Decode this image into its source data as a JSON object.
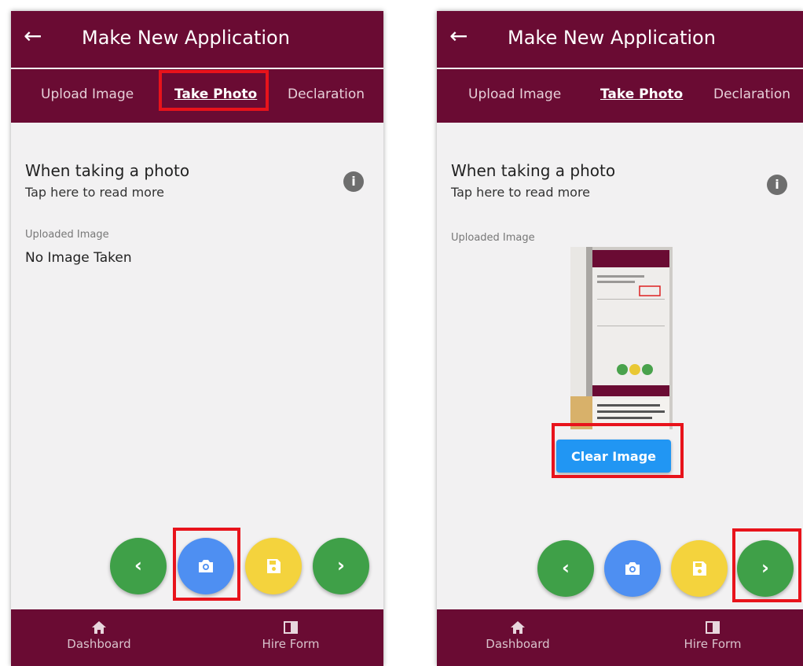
{
  "screens": [
    {
      "appbar": {
        "back_icon": "arrow-left-icon",
        "title": "Make New Application"
      },
      "tabs": [
        {
          "label": "Upload Image",
          "active": false
        },
        {
          "label": "Take Photo",
          "active": true
        },
        {
          "label": "Declaration",
          "active": false
        }
      ],
      "intro": {
        "title": "When taking a photo",
        "subtitle": "Tap here to read more",
        "icon": "info-icon"
      },
      "uploaded": {
        "label": "Uploaded Image",
        "value": "No Image Taken"
      },
      "fabs": [
        {
          "name": "previous",
          "icon": "chevron-left-icon",
          "color": "#3fa048"
        },
        {
          "name": "take-photo",
          "icon": "camera-icon",
          "color": "#4e8ff2"
        },
        {
          "name": "save",
          "icon": "save-icon",
          "color": "#f4d33d"
        },
        {
          "name": "next",
          "icon": "chevron-right-icon",
          "color": "#3fa048"
        }
      ],
      "bottom_nav": [
        {
          "label": "Dashboard",
          "icon": "home-icon"
        },
        {
          "label": "Hire Form",
          "icon": "form-icon"
        }
      ],
      "highlights": [
        "Take Photo tab",
        "camera button"
      ]
    },
    {
      "appbar": {
        "back_icon": "arrow-left-icon",
        "title": "Make New Application"
      },
      "tabs": [
        {
          "label": "Upload Image",
          "active": false
        },
        {
          "label": "Take Photo",
          "active": true
        },
        {
          "label": "Declaration",
          "active": false
        }
      ],
      "intro": {
        "title": "When taking a photo",
        "subtitle": "Tap here to read more",
        "icon": "info-icon"
      },
      "uploaded": {
        "label": "Uploaded Image",
        "clear_button": "Clear Image"
      },
      "fabs": [
        {
          "name": "previous",
          "icon": "chevron-left-icon",
          "color": "#3fa048"
        },
        {
          "name": "take-photo",
          "icon": "camera-icon",
          "color": "#4e8ff2"
        },
        {
          "name": "save",
          "icon": "save-icon",
          "color": "#f4d33d"
        },
        {
          "name": "next",
          "icon": "chevron-right-icon",
          "color": "#3fa048"
        }
      ],
      "bottom_nav": [
        {
          "label": "Dashboard",
          "icon": "home-icon"
        },
        {
          "label": "Hire Form",
          "icon": "form-icon"
        }
      ],
      "highlights": [
        "Clear Image button",
        "next button"
      ]
    }
  ],
  "colors": {
    "brand": "#6a0b33",
    "highlight": "#e8131b",
    "clear_button": "#2196f3"
  }
}
